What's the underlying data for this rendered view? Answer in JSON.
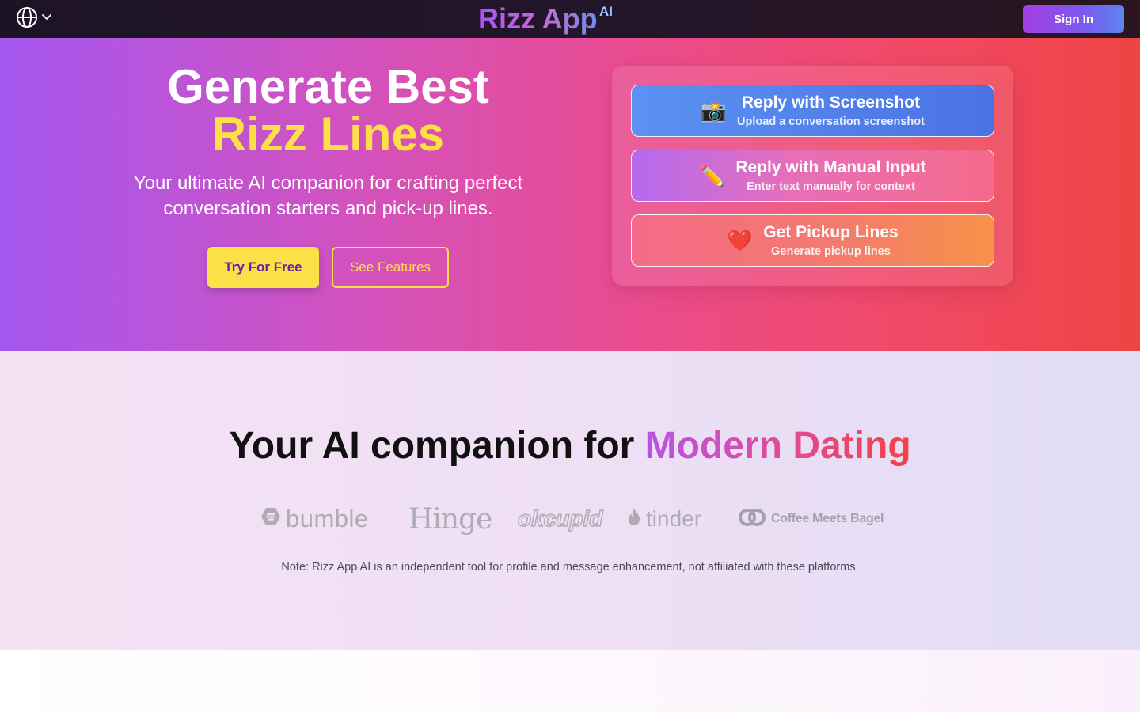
{
  "header": {
    "brand": "Rizz App",
    "brand_superscript": "AI",
    "language_icon": "globe-icon",
    "dropdown_icon": "chevron-down-icon",
    "sign_in_label": "Sign In"
  },
  "hero": {
    "title_line1": "Generate Best",
    "title_line2": "Rizz Lines",
    "subtitle": "Your ultimate AI companion for crafting perfect conversation starters and pick-up lines.",
    "try_button": "Try For Free",
    "features_button": "See Features",
    "options": [
      {
        "emoji": "📸",
        "title": "Reply with Screenshot",
        "description": "Upload a conversation screenshot"
      },
      {
        "emoji": "✏️",
        "title": "Reply with Manual Input",
        "description": "Enter text manually for context"
      },
      {
        "emoji": "❤️",
        "title": "Get Pickup Lines",
        "description": "Generate pickup lines"
      }
    ]
  },
  "dating": {
    "heading_plain": "Your AI companion for ",
    "heading_highlight": "Modern Dating",
    "logos": [
      "bumble",
      "Hinge",
      "okcupid",
      "tinder",
      "Coffee Meets Bagel"
    ],
    "note": "Note: Rizz App AI is an independent tool for profile and message enhancement, not affiliated with these platforms."
  },
  "colors": {
    "accent_yellow": "#fde047",
    "hero_start": "#a457f0",
    "hero_end": "#ef4444",
    "logo_gray": "#b0aab4"
  }
}
